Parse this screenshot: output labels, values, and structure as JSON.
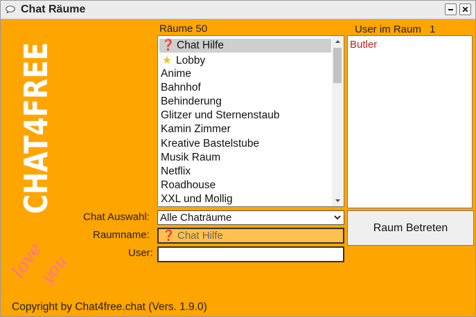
{
  "window": {
    "title": "Chat Räume",
    "title_icon": "chat-bubble-icon",
    "minimize_icon": "minimize-icon",
    "close_icon": "close-icon"
  },
  "branding": {
    "logo_text": "CHAT4FREE",
    "love_text_1": "love",
    "love_text_2": "you"
  },
  "rooms": {
    "header": "Räume 50",
    "items": [
      {
        "label": "Chat Hilfe",
        "icon": "question-icon",
        "selected": true
      },
      {
        "label": "Lobby",
        "icon": "star-icon",
        "selected": false
      },
      {
        "label": "Anime"
      },
      {
        "label": "Bahnhof"
      },
      {
        "label": "Behinderung"
      },
      {
        "label": "Glitzer und Sternenstaub"
      },
      {
        "label": "Kamin Zimmer"
      },
      {
        "label": "Kreative Bastelstube"
      },
      {
        "label": "Musik Raum"
      },
      {
        "label": "Netflix"
      },
      {
        "label": "Roadhouse"
      },
      {
        "label": "XXL und Mollig"
      }
    ]
  },
  "users": {
    "header": "User im Raum",
    "count": "1",
    "items": [
      "Butler"
    ]
  },
  "form": {
    "chat_select_label": "Chat Auswahl:",
    "chat_select_value": "Alle Chaträume",
    "roomname_label": "Raumname:",
    "roomname_value": "Chat Hilfe",
    "user_label": "User:",
    "user_value": ""
  },
  "enter_button": "Raum Betreten",
  "copyright": "Copyright by Chat4free.chat (Vers. 1.9.0)",
  "colors": {
    "background": "#ffa500",
    "roomname_field": "#ffc04d",
    "user_name": "#c02020"
  }
}
